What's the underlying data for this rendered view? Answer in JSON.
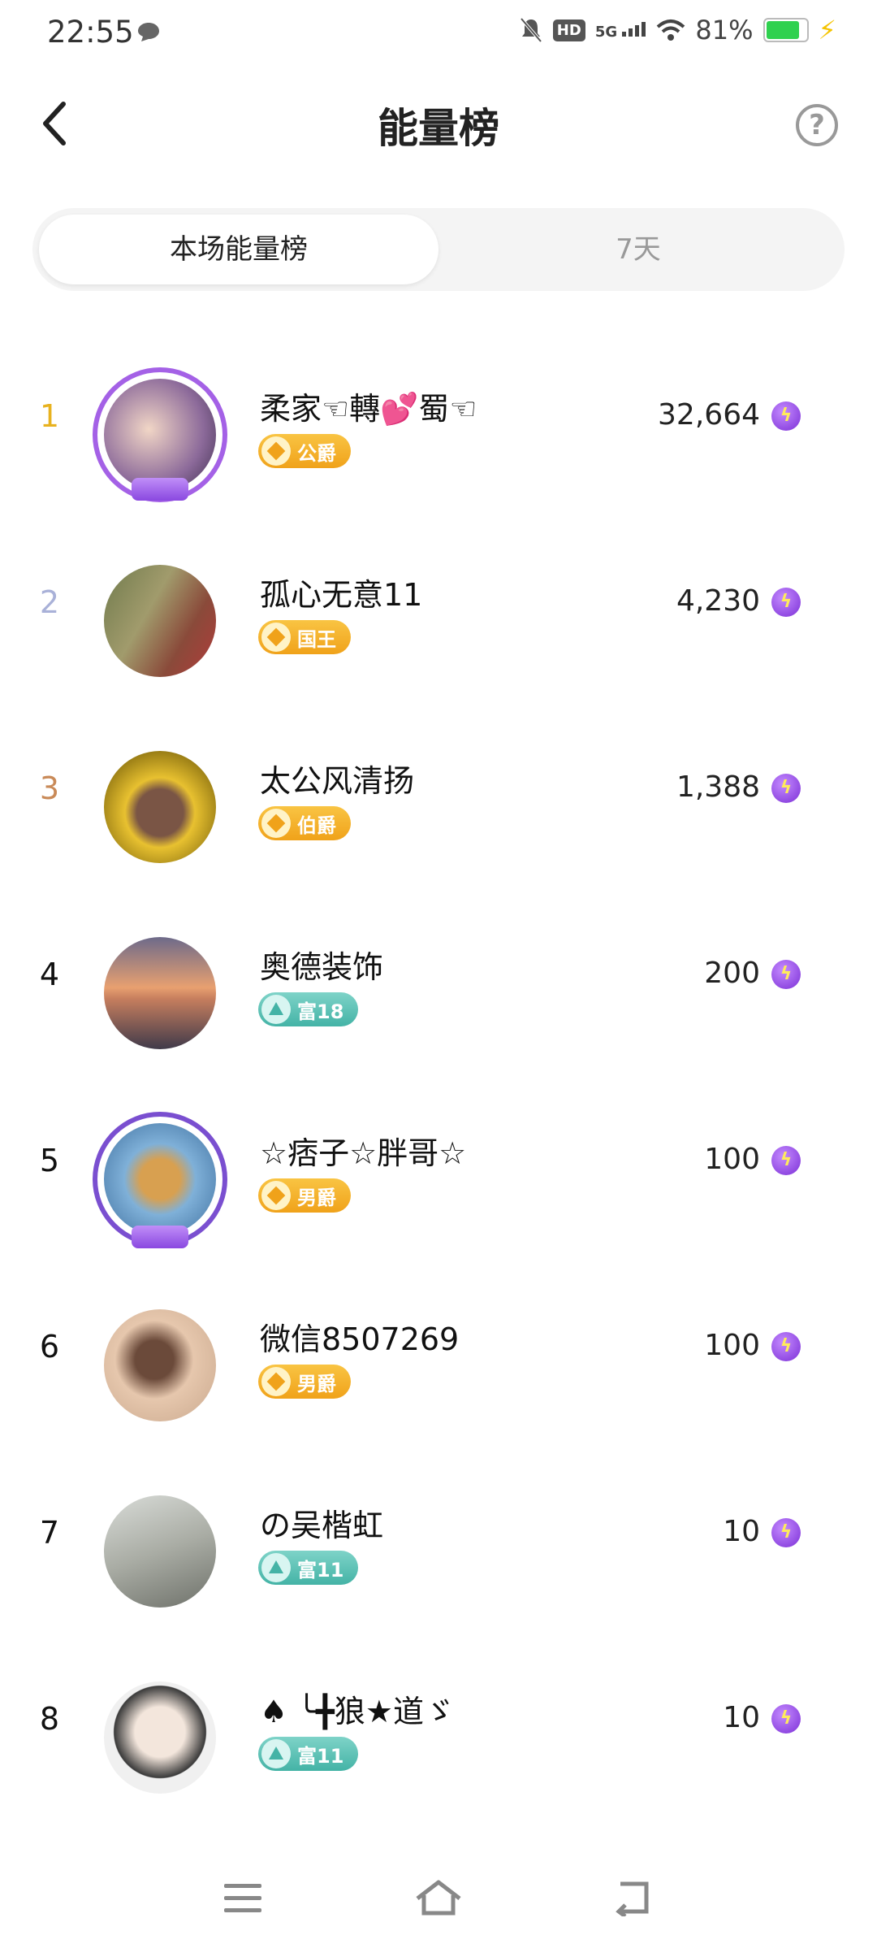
{
  "status_bar": {
    "time": "22:55",
    "battery": "81%",
    "network": "5G",
    "hd": "HD"
  },
  "header": {
    "title": "能量榜",
    "help": "?"
  },
  "tabs": [
    {
      "label": "本场能量榜",
      "active": true
    },
    {
      "label": "7天",
      "active": false
    }
  ],
  "colors": {
    "rank1": "#e8b21f",
    "rank2": "#a9b1d8",
    "rank3": "#c98a58",
    "gold_badge": "#f0a21a",
    "teal_badge": "#44b3a6",
    "energy": "#7b2fd6"
  },
  "rankings": [
    {
      "rank": "1",
      "name": "柔家☜轉💕蜀☜",
      "badge": "公爵",
      "badge_type": "gold",
      "score": "32,664"
    },
    {
      "rank": "2",
      "name": "孤心无意11",
      "badge": "国王",
      "badge_type": "gold",
      "score": "4,230"
    },
    {
      "rank": "3",
      "name": "太公风清扬",
      "badge": "伯爵",
      "badge_type": "gold",
      "score": "1,388"
    },
    {
      "rank": "4",
      "name": "奥德装饰",
      "badge": "富18",
      "badge_type": "teal",
      "score": "200"
    },
    {
      "rank": "5",
      "name": "☆痞子☆胖哥☆",
      "badge": "男爵",
      "badge_type": "gold",
      "score": "100"
    },
    {
      "rank": "6",
      "name": "微信8507269",
      "badge": "男爵",
      "badge_type": "gold",
      "score": "100"
    },
    {
      "rank": "7",
      "name": "の吴楷虹",
      "badge": "富11",
      "badge_type": "teal",
      "score": "10"
    },
    {
      "rank": "8",
      "name": "♠ ╰╋狼★道ゞ",
      "badge": "富11",
      "badge_type": "teal",
      "score": "10"
    }
  ]
}
